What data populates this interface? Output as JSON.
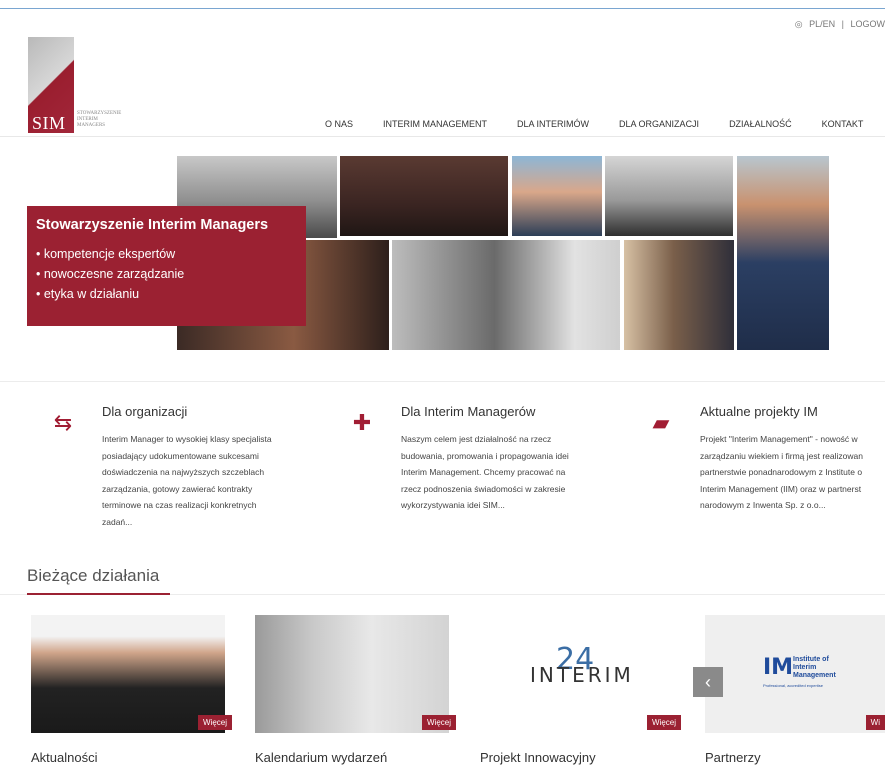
{
  "header": {
    "lang": "PL/EN",
    "login": "LOGOW",
    "logo_text": "SIM",
    "logo_small": [
      "Stowarzyszenie",
      "Interim",
      "Managers"
    ]
  },
  "nav": [
    "O NAS",
    "INTERIM MANAGEMENT",
    "DLA INTERIMÓW",
    "DLA ORGANIZACJI",
    "DZIAŁALNOŚĆ",
    "KONTAKT"
  ],
  "hero": {
    "title": "Stowarzyszenie Interim Managers",
    "bullets": [
      "kompetencje ekspertów",
      "nowoczesne zarządzanie",
      "etyka w działaniu"
    ]
  },
  "columns": [
    {
      "title": "Dla organizacji",
      "icon": "swap-arrows-icon",
      "text": [
        "Interim Manager to wysokiej klasy specjalista",
        "posiadający udokumentowane sukcesami",
        "doświadczenia na najwyższych szczeblach",
        "zarządzania, gotowy zawierać kontrakty",
        "terminowe na czas realizacji konkretnych",
        "zadań..."
      ]
    },
    {
      "title": "Dla Interim Managerów",
      "icon": "puzzle-icon",
      "text": [
        "Naszym celem jest działalność na rzecz",
        "budowania, promowania i propagowania idei",
        "Interim Management. Chcemy pracować na",
        "rzecz podnoszenia świadomości w zakresie",
        "wykorzystywania idei SIM..."
      ]
    },
    {
      "title": "Aktualne projekty IM",
      "icon": "folder-open-icon",
      "text": [
        "Projekt \"Interim Management\" - nowość w",
        "zarządzaniu wiekiem i firmą jest realizowan",
        "partnerstwie ponadnarodowym z Institute o",
        "Interim Management (IIM) oraz w partnerst",
        "narodowym z Inwenta Sp. z o.o..."
      ]
    }
  ],
  "section": {
    "title": "Bieżące działania"
  },
  "cards": [
    {
      "caption": "Aktualności",
      "more": "Więcej"
    },
    {
      "caption": "Kalendarium wydarzeń",
      "more": "Więcej"
    },
    {
      "caption": "Projekt Innowacyjny",
      "more": "Więcej",
      "logo_word": "INTERIM",
      "logo_num": "24"
    },
    {
      "caption": "Partnerzy",
      "more": "Wi",
      "logo_mark": "IM",
      "logo_lines": "Institute of Interim Management",
      "logo_sub": "Professional, accredited expertise"
    }
  ],
  "carousel": {
    "prev": "‹"
  }
}
